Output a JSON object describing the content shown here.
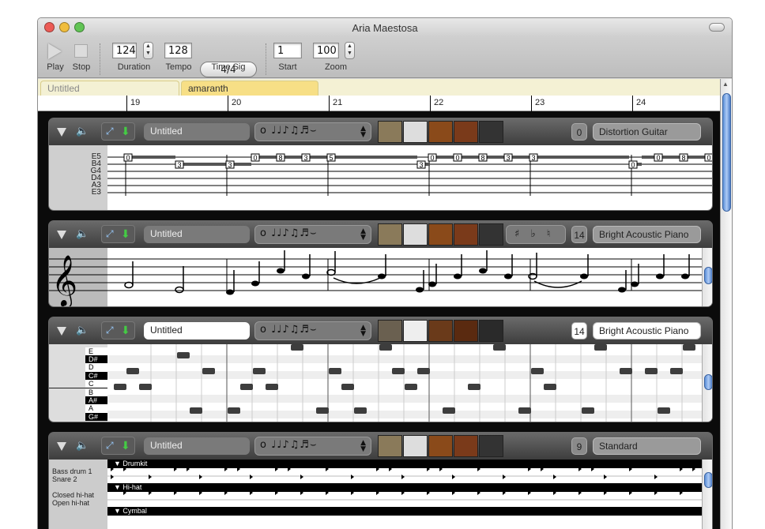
{
  "window": {
    "title": "Aria Maestosa"
  },
  "toolbar": {
    "play_label": "Play",
    "stop_label": "Stop",
    "duration_label": "Duration",
    "duration_value": "124",
    "tempo_label": "Tempo",
    "tempo_value": "128",
    "timesig_label": "Time Sig",
    "timesig_value": "4/4",
    "start_label": "Start",
    "start_value": "1",
    "zoom_label": "Zoom",
    "zoom_value": "100"
  },
  "tabs": [
    {
      "label": "Untitled"
    },
    {
      "label": "amaranth"
    }
  ],
  "ruler": {
    "measures": [
      "19",
      "20",
      "21",
      "22",
      "23",
      "24"
    ]
  },
  "tracks": [
    {
      "name": "Untitled",
      "channel": "0",
      "instrument": "Distortion Guitar",
      "strings": [
        "E5",
        "B4",
        "G4",
        "D4",
        "A3",
        "E3"
      ]
    },
    {
      "name": "Untitled",
      "channel": "14",
      "instrument": "Bright Acoustic Piano",
      "accidentals": [
        "♯",
        "♭",
        "♮"
      ]
    },
    {
      "name": "Untitled",
      "channel": "14",
      "instrument": "Bright Acoustic Piano",
      "keys": [
        "E",
        "D#",
        "D",
        "C#",
        "C",
        "B",
        "A#",
        "A",
        "G#"
      ]
    },
    {
      "name": "Untitled",
      "channel": "9",
      "instrument": "Standard",
      "drum_names": [
        "Bass drum 1",
        "Snare 2",
        "Closed hi-hat",
        "Open hi-hat"
      ],
      "groups": [
        "Drumkit",
        "Hi-hat",
        "Cymbal"
      ]
    }
  ],
  "durations": "o ♩♩♪♫♬⌣",
  "tab_numbers": [
    "0",
    "3",
    "3",
    "0",
    "8",
    "3",
    "5",
    "3",
    "0",
    "0",
    "8",
    "3",
    "3",
    "0",
    "8",
    "0"
  ],
  "colors": {
    "timeline_bg": "#0b0b0b",
    "tab_bg": "#f4f1d4",
    "scroll_thumb": "#5b8fd8"
  }
}
